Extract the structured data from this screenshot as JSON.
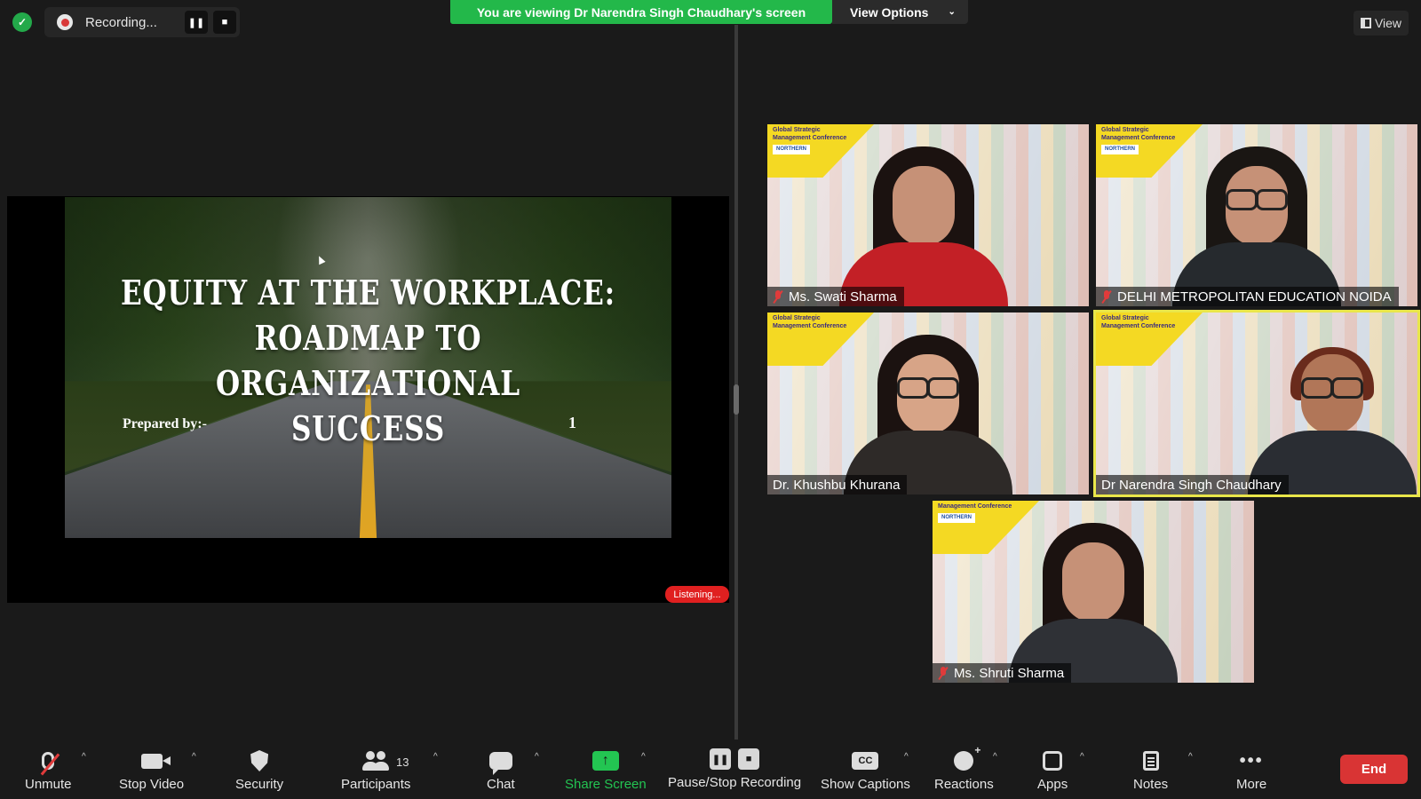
{
  "topbar": {
    "recording_label": "Recording...",
    "viewing_banner": "You are viewing Dr Narendra Singh Chaudhary's screen",
    "view_options_label": "View Options",
    "view_label": "View"
  },
  "shared_screen": {
    "slide": {
      "title_line1": "EQUITY AT THE WORKPLACE:",
      "title_line2": "ROADMAP TO ORGANIZATIONAL",
      "title_line3": "SUCCESS",
      "prepared_by": "Prepared by:-",
      "slide_number": "1"
    },
    "listening_badge": "Listening..."
  },
  "participants": [
    {
      "name": "Ms. Swati Sharma",
      "muted": true,
      "active_speaker": false
    },
    {
      "name": "DELHI METROPOLITAN EDUCATION NOIDA",
      "muted": true,
      "active_speaker": false
    },
    {
      "name": "Dr. Khushbu Khurana",
      "muted": false,
      "active_speaker": false
    },
    {
      "name": "Dr Narendra Singh Chaudhary",
      "muted": false,
      "active_speaker": true
    },
    {
      "name": "Ms. Shruti Sharma",
      "muted": true,
      "active_speaker": false
    }
  ],
  "toolbar": {
    "unmute": "Unmute",
    "stop_video": "Stop Video",
    "security": "Security",
    "participants": "Participants",
    "participants_count": "13",
    "chat": "Chat",
    "share_screen": "Share Screen",
    "pause_stop_recording": "Pause/Stop Recording",
    "show_captions": "Show Captions",
    "cc_glyph": "CC",
    "reactions": "Reactions",
    "apps": "Apps",
    "notes": "Notes",
    "more": "More",
    "end": "End"
  },
  "icons": {
    "security_status": "shield-check-icon",
    "share_arrow": "↑",
    "pause_glyph": "❚❚",
    "stop_glyph": "■",
    "more_glyph": "•••"
  },
  "colors": {
    "accent_green": "#23b84a",
    "end_red": "#d93434",
    "active_speaker": "#e9e64a"
  }
}
